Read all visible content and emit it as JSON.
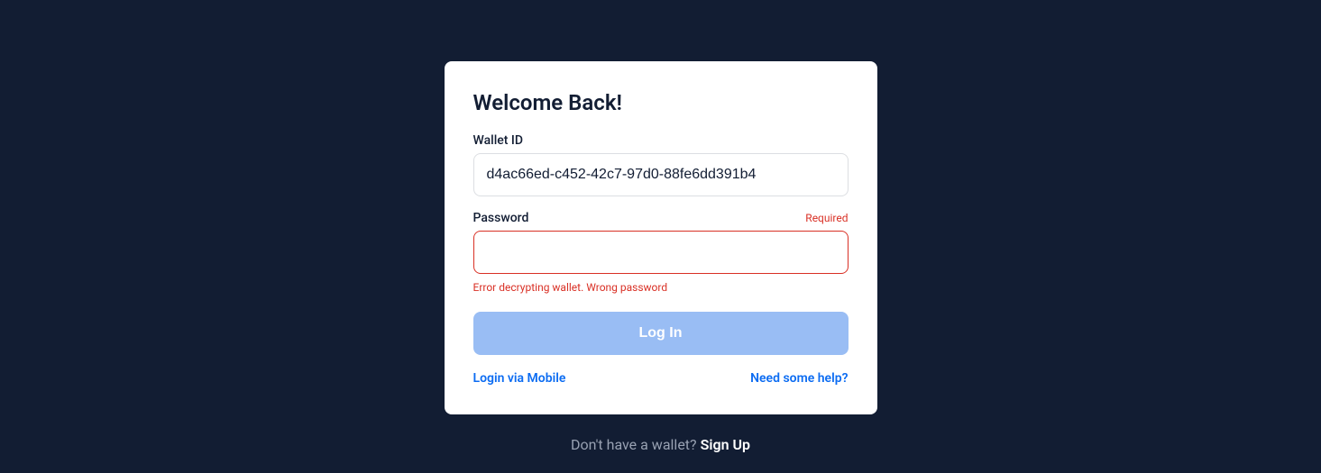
{
  "card": {
    "heading": "Welcome Back!",
    "walletId": {
      "label": "Wallet ID",
      "value": "d4ac66ed-c452-42c7-97d0-88fe6dd391b4"
    },
    "password": {
      "label": "Password",
      "required": "Required",
      "value": "",
      "error": "Error decrypting wallet. Wrong password"
    },
    "loginButton": "Log In",
    "links": {
      "mobile": "Login via Mobile",
      "help": "Need some help?"
    }
  },
  "footer": {
    "prompt": "Don't have a wallet? ",
    "signup": "Sign Up"
  }
}
